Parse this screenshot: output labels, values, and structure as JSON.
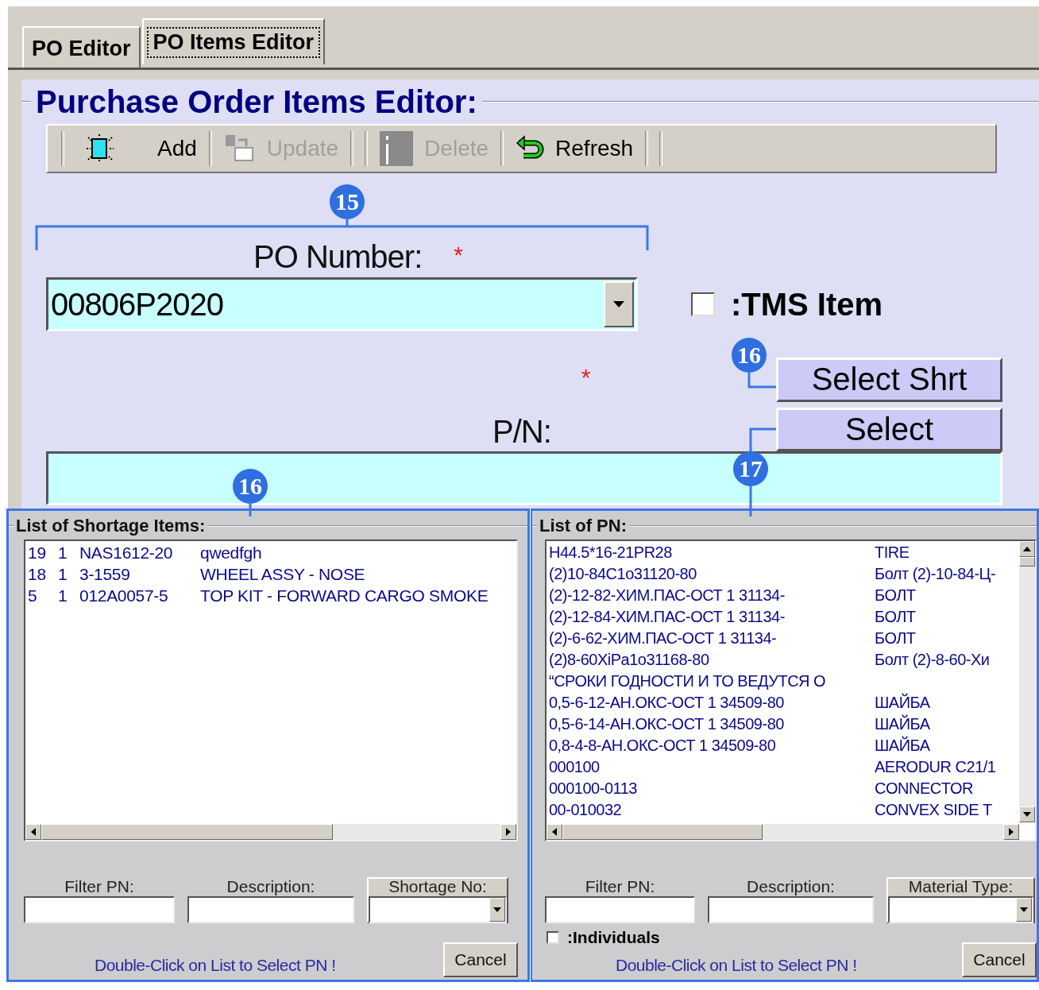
{
  "tabs": [
    {
      "label": "PO Editor",
      "selected": false
    },
    {
      "label": "PO Items Editor",
      "selected": true
    }
  ],
  "editor": {
    "title": "Purchase Order Items Editor:",
    "toolbar": [
      {
        "label": "Add",
        "disabled": false
      },
      {
        "label": "Update",
        "disabled": true
      },
      {
        "label": "Delete",
        "disabled": true
      },
      {
        "label": "Refresh",
        "disabled": false
      }
    ],
    "po_number": {
      "label": "PO Number:",
      "required_mark": "*",
      "value": "00806P2020"
    },
    "tms_item": {
      "label": ":TMS Item",
      "checked": false
    },
    "select_shrt_button": "Select Shrt",
    "select_button": "Select",
    "pn": {
      "label": "P/N:",
      "required_mark": "*"
    }
  },
  "shortage_panel": {
    "title": "List of Shortage Items:",
    "rows": [
      {
        "no": "19",
        "qty": "1",
        "pn": "NAS1612-20",
        "description": "qwedfgh"
      },
      {
        "no": "18",
        "qty": "1",
        "pn": "3-1559",
        "description": "WHEEL ASSY - NOSE"
      },
      {
        "no": "5",
        "qty": "1",
        "pn": "012A0057-5",
        "description": "TOP KIT - FORWARD CARGO SMOKE"
      }
    ],
    "filters": [
      {
        "label": "Filter PN:",
        "kind": "text"
      },
      {
        "label": "Description:",
        "kind": "text"
      },
      {
        "label": "Shortage No:",
        "kind": "dropdown"
      }
    ],
    "hint": "Double-Click on List to Select PN !",
    "cancel_button": "Cancel"
  },
  "pn_panel": {
    "title": "List of PN:",
    "rows": [
      {
        "pn": "H44.5*16-21PR28",
        "description": "TIRE"
      },
      {
        "pn": "(2)10-84C1o31120-80",
        "description": "Болт (2)-10-84-Ц-"
      },
      {
        "pn": "(2)-12-82-ХИМ.ПАС-ОСТ 1 31134-",
        "description": "БОЛТ"
      },
      {
        "pn": "(2)-12-84-ХИМ.ПАС-ОСТ 1 31134-",
        "description": "БОЛТ"
      },
      {
        "pn": "(2)-6-62-ХИМ.ПАС-ОСТ 1 31134-",
        "description": "БОЛТ"
      },
      {
        "pn": "(2)8-60XiPa1o31168-80",
        "description": "Болт (2)-8-60-Хи"
      },
      {
        "pn": "“СРОКИ ГОДНОСТИ И ТО ВЕДУТСЯ О"
      },
      {
        "pn": "0,5-6-12-АН.ОКС-ОСТ 1 34509-80",
        "description": "ШАЙБА"
      },
      {
        "pn": "0,5-6-14-АН.ОКС-ОСТ 1 34509-80",
        "description": "ШАЙБА"
      },
      {
        "pn": "0,8-4-8-АН.ОКС-ОСТ 1 34509-80",
        "description": "ШАЙБА"
      },
      {
        "pn": "000100",
        "description": "AERODUR C21/1"
      },
      {
        "pn": "000100-0113",
        "description": "CONNECTOR"
      },
      {
        "pn": "00-010032",
        "description": "CONVEX SIDE T"
      }
    ],
    "filters": [
      {
        "label": "Filter PN:",
        "kind": "text"
      },
      {
        "label": "Description:",
        "kind": "text"
      },
      {
        "label": "Material Type:",
        "kind": "dropdown"
      }
    ],
    "individuals": {
      "label": ":Individuals",
      "checked": false
    },
    "hint": "Double-Click on List to Select PN !",
    "cancel_button": "Cancel"
  },
  "callouts": [
    {
      "number": "15"
    },
    {
      "number": "16"
    },
    {
      "number": "16"
    },
    {
      "number": "17"
    }
  ]
}
